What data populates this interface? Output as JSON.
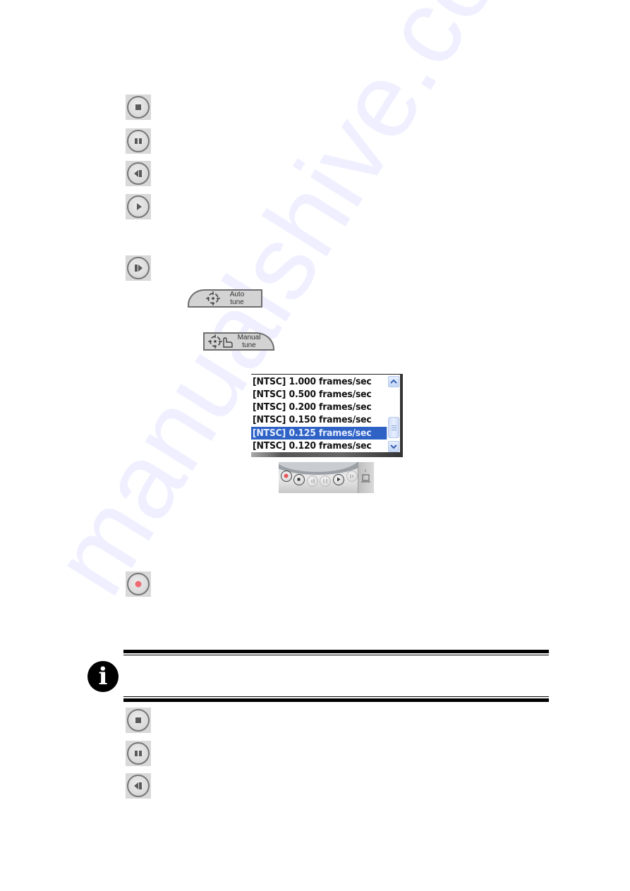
{
  "watermark": {
    "text": "manualshive.com"
  },
  "playback_icons_top": [
    {
      "name": "stop",
      "icon": "stop-icon"
    },
    {
      "name": "pause",
      "icon": "pause-icon"
    },
    {
      "name": "step-back",
      "icon": "step-back-icon"
    },
    {
      "name": "play",
      "icon": "play-icon"
    },
    {
      "name": "step-forward",
      "icon": "step-forward-icon"
    }
  ],
  "tune_buttons": {
    "auto": {
      "line1": "Auto",
      "line2": "tune",
      "icon": "crosshair-icon"
    },
    "manual": {
      "line1": "Manual",
      "line2": "tune",
      "icon": "crosshair-hand-icon"
    }
  },
  "frame_rate_list": {
    "items": [
      {
        "standard": "[NTSC]",
        "rate": "1.000 frames/sec",
        "selected": false
      },
      {
        "standard": "[NTSC]",
        "rate": "0.500 frames/sec",
        "selected": false
      },
      {
        "standard": "[NTSC]",
        "rate": "0.200 frames/sec",
        "selected": false
      },
      {
        "standard": "[NTSC]",
        "rate": "0.150 frames/sec",
        "selected": false
      },
      {
        "standard": "[NTSC]",
        "rate": "0.125 frames/sec",
        "selected": true
      },
      {
        "standard": "[NTSC]",
        "rate": "0.120 frames/sec",
        "selected": false
      }
    ],
    "scroll_up": "^",
    "scroll_down": "v",
    "highlight_color": "#2f62c5"
  },
  "mini_player": {
    "buttons": [
      "record",
      "stop",
      "step-back",
      "pause",
      "play",
      "step-forward"
    ]
  },
  "record_icon": {
    "name": "record",
    "icon": "record-icon",
    "color": "#f06a74"
  },
  "note": {
    "icon": "info-icon",
    "glyph": "i"
  },
  "playback_icons_bottom": [
    {
      "name": "stop",
      "icon": "stop-icon"
    },
    {
      "name": "pause",
      "icon": "pause-icon"
    },
    {
      "name": "step-back",
      "icon": "step-back-icon"
    }
  ]
}
